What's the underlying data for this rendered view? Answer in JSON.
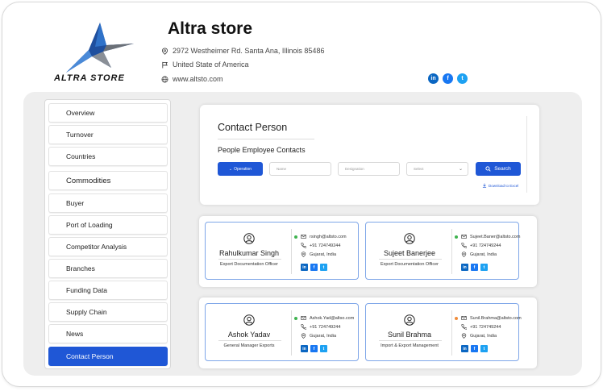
{
  "store": {
    "name": "Altra store",
    "logo_text": "ALTRA STORE",
    "address": "2972 Westheimer Rd. Santa Ana, Illinois 85486",
    "country": "United State of America",
    "website": "www.altsto.com",
    "social": [
      "in",
      "f",
      "t"
    ]
  },
  "sidebar": {
    "items": [
      {
        "label": "Overview"
      },
      {
        "label": "Turnover"
      },
      {
        "label": "Countries"
      },
      {
        "label": "Commodities"
      },
      {
        "label": "Buyer"
      },
      {
        "label": "Port of Loading"
      },
      {
        "label": "Competitor Analysis"
      },
      {
        "label": "Branches"
      },
      {
        "label": "Funding Data"
      },
      {
        "label": "Supply Chain"
      },
      {
        "label": "News"
      },
      {
        "label": "Contact Person"
      }
    ],
    "active": "Contact Person"
  },
  "contact_box": {
    "title": "Contact Person",
    "subtitle": "People Employee Contacts",
    "filter_dropdown": "Operation",
    "name_placeholder": "Name",
    "designation_placeholder": "Designation",
    "select_placeholder": "Select",
    "search_label": "Search",
    "download_label": "Download to Excel"
  },
  "contacts": [
    {
      "name": "Rahulkumar Singh",
      "role": "Export Documentation Officer",
      "email": "rsingh@altsto.com",
      "phone": "+91 724749244",
      "location": "Gujarat, India",
      "status": "green"
    },
    {
      "name": "Sujeet Banerjee",
      "role": "Export Documentation Officer",
      "email": "Sujeet.Baner@altsto.com",
      "phone": "+91 724749244",
      "location": "Gujarat, India",
      "status": "green"
    },
    {
      "name": "Ashok Yadav",
      "role": "General Manager Exports",
      "email": "Ashok.Yad@altso.com",
      "phone": "+91 724749244",
      "location": "Gujarat, India",
      "status": "green"
    },
    {
      "name": "Sunil Brahma",
      "role": "Import & Export Management",
      "email": "Sunil.Brahma@altsto.com",
      "phone": "+91 724749244",
      "location": "Gujarat, India",
      "status": "orange"
    }
  ],
  "colors": {
    "accent": "#1f57d6",
    "card_border": "#7ea6e8",
    "panel": "#eeeeee"
  }
}
